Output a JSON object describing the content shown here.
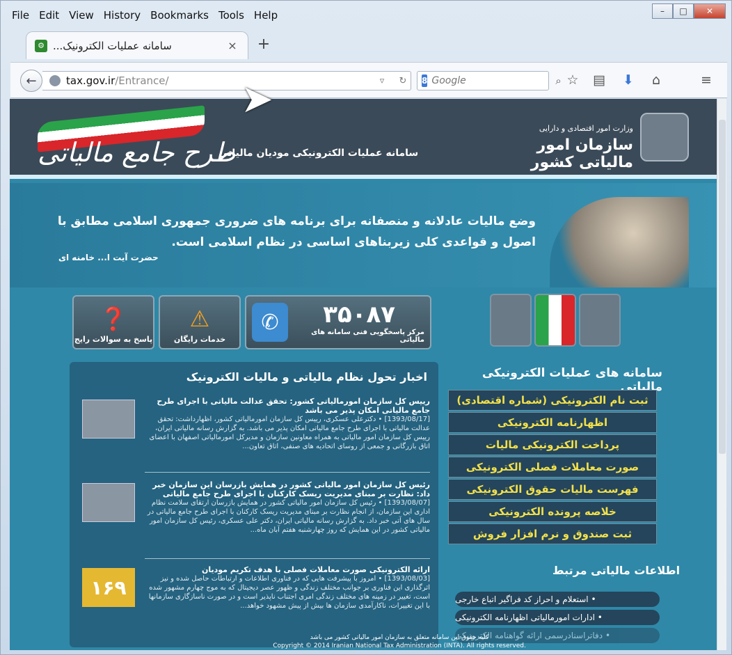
{
  "menubar": {
    "items": [
      "File",
      "Edit",
      "View",
      "History",
      "Bookmarks",
      "Tools",
      "Help"
    ]
  },
  "window": {
    "minimize": "–",
    "maximize": "□",
    "close": "✕"
  },
  "tab": {
    "title": "سامانه عملیات الکترونیک...",
    "close": "×",
    "new": "+"
  },
  "nav": {
    "url_domain": "tax.gov.ir",
    "url_path": "/Entrance/",
    "search_placeholder": "Google",
    "search_engine": "8"
  },
  "header": {
    "org_small": "وزارت امور اقتصادی و دارایی",
    "org_big": "سازمان امور مالیاتی کشور",
    "system_name": "سامانه عملیات الکترونیکی مودیان مالیاتی",
    "logo_text": "طرح جامع مالیاتی"
  },
  "hero": {
    "quote": "وضع مالیات عادلانه و منصفانه برای برنامه های ضروری جمهوری اسلامی مطابق با اصول و قواعدی کلی زیربناهای اساسی در نظام اسلامی است.",
    "author": "حضرت آیت ا... خامنه ای"
  },
  "tiles": {
    "faq": "پاسخ به سوالات رایج",
    "free": "خدمات رایگان",
    "phone_number": "۳۵۰۸۷",
    "phone_caption": "مرکز پاسخگویی فنی سامانه های مالیاتی"
  },
  "news": {
    "title": "اخبار تحول نظام مالیاتی و مالیات الکترونیک",
    "items": [
      {
        "head": "رییس کل سازمان امورمالیاتی کشور: تحقق عدالت مالیاتی با اجرای طرح جامع مالیاتی امکان پذیر می باشد",
        "body": "[1393/08/17] • دکترعلی عسکری، رییس کل سازمان امورمالیاتی کشور، اظهارداشت: تحقق عدالت مالیاتی با اجرای طرح جامع مالیاتی امکان پذیر می باشد. به گزارش رسانه مالیاتی ایران، رییس کل سازمان امور مالیاتی به همراه معاونین سازمان و مدیرکل امورمالیاتی اصفهان با اعضای اتاق بازرگانی و جمعی از روسای اتحادیه های صنفی، اتاق تعاون..."
      },
      {
        "head": "رئیس کل سازمان امور مالیاتی کشور در همایش بازرسان این سازمان خبر داد: نظارت بر مبنای مدیریت ریسک کارکنان با اجرای طرح جامع مالیاتی",
        "body": "[1393/08/07] • رئیس کل سازمان امور مالیاتی کشور در همایش بازرسان ارتقای سلامت نظام اداری این سازمان، از انجام نظارت بر مبنای مدیریت ریسک کارکنان با اجرای طرح جامع مالیاتی در سال های آتی خبر داد. به گزارش رسانه مالیاتی ایران، دکتر علی عسکری، رئیس کل سازمان امور مالیاتی کشور در این همایش که روز چهارشنبه هفتم آبان ماه..."
      },
      {
        "head": "ارائه الکترونیکی صورت معاملات فصلی با هدف تکریم مودیان",
        "body": "[1393/08/03] • امروز با پیشرفت هایی که در فناوری اطلاعات و ارتباطات حاصل شده و نیز اثرگذاری این فناوری بر جوانب مختلف زندگی و ظهور عصر دیجیتال که به موج چهارم مشهور شده است، تغییر در زمینه های مختلف زندگی امری اجتناب ناپذیر است و در صورت ناسازگاری سازمانها با این تغییرات، ناکارآمدی سازمان ها بیش از پیش مشهود خواهد...",
        "badge": "۱۶۹"
      }
    ]
  },
  "services": {
    "title": "سامانه های عملیات الکترونیکی مالیاتی",
    "items": [
      "ثبت نام الکترونیکی (شماره اقتصادی)",
      "اظهارنامه الکترونیکی",
      "پرداخت الکترونیکی مالیات",
      "صورت معاملات فصلی الکترونیکی",
      "فهرست مالیات حقوق الکترونیکی",
      "خلاصه پرونده الکترونیکی",
      "ثبت صندوق و نرم افزار فروش"
    ]
  },
  "related": {
    "title": "اطلاعات مالیاتی مرتبط",
    "items": [
      "• استعلام و احراز کد فراگیر اتباع خارجی",
      "• ادارات امورمالیاتی اظهارنامه الکترونیکی",
      "• دفاتراسنادرسمی ارائه گواهنامه الکترونیکی"
    ]
  },
  "footer": {
    "line1": "کلیه حقوق این سامانه متعلق به سازمان امور مالیاتی کشور می باشد",
    "line2": "Copyright © 2014 Iranian National Tax Administration (INTA). All rights reserved."
  },
  "colors": {
    "page_bg": "#2f88a8",
    "service_text": "#f3e04a",
    "header_bg": "#3b4a58"
  }
}
